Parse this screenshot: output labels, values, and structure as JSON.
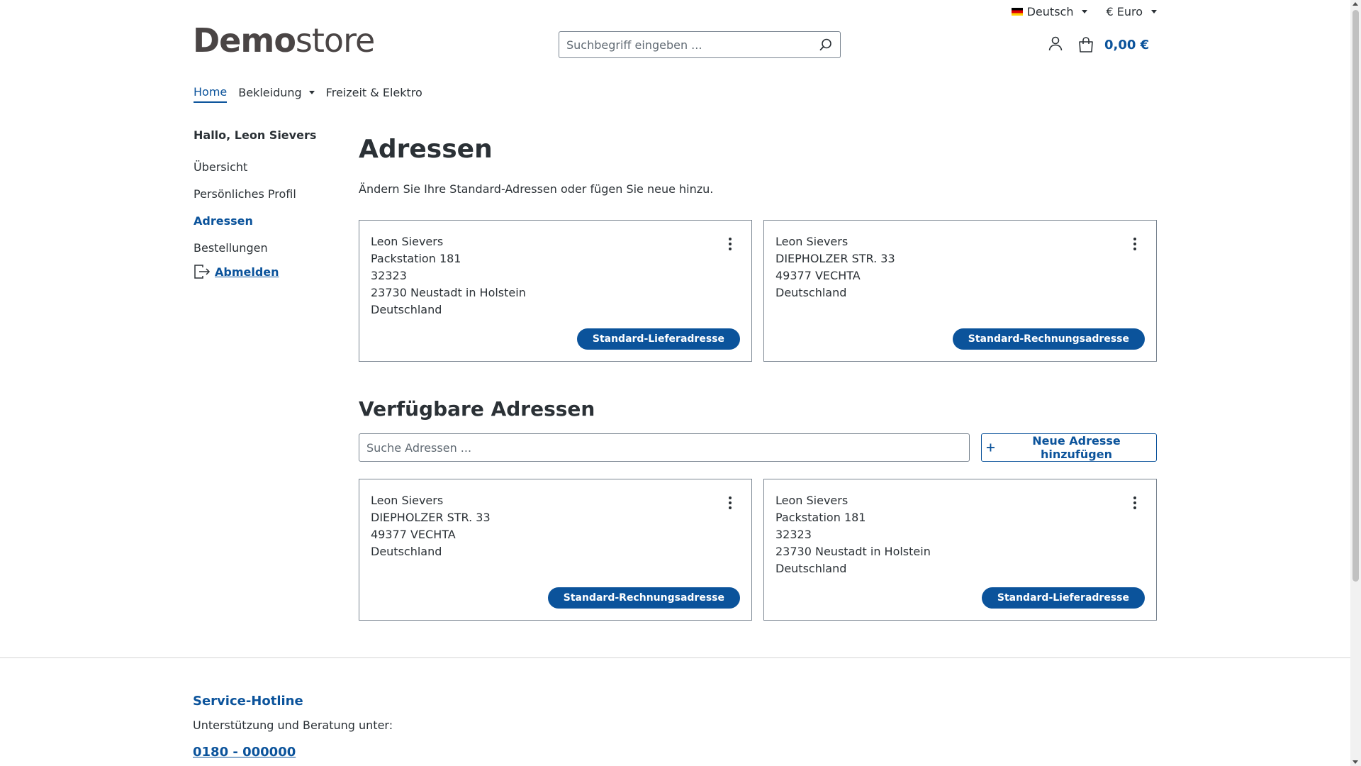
{
  "topbar": {
    "language": {
      "label": "Deutsch",
      "icon": "germany-flag-icon"
    },
    "currency": {
      "label": "€ Euro"
    }
  },
  "header": {
    "logo": {
      "bold": "Demo",
      "light": "store"
    },
    "search": {
      "placeholder": "Suchbegriff eingeben ...",
      "value": "",
      "icon": "search-icon"
    },
    "account_icon": "user-icon",
    "cart": {
      "icon": "shopping-bag-icon",
      "total": "0,00 €"
    }
  },
  "nav": {
    "items": [
      {
        "label": "Home",
        "active": true
      },
      {
        "label": "Bekleidung",
        "dropdown": true
      },
      {
        "label": "Freizeit & Elektro"
      }
    ]
  },
  "sidebar": {
    "greeting": "Hallo, Leon Sievers",
    "items": [
      {
        "label": "Übersicht"
      },
      {
        "label": "Persönliches Profil"
      },
      {
        "label": "Adressen",
        "active": true
      },
      {
        "label": "Bestellungen"
      }
    ],
    "logout": {
      "label": "Abmelden",
      "icon": "logout-icon"
    }
  },
  "main": {
    "title": "Adressen",
    "subtitle": "Ändern Sie Ihre Standard-Adressen oder fügen Sie neue hinzu.",
    "default_addresses": [
      {
        "lines": [
          "Leon Sievers",
          "Packstation 181",
          "32323",
          "23730 Neustadt in Holstein",
          "Deutschland"
        ],
        "badge": "Standard-Lieferadresse"
      },
      {
        "lines": [
          "Leon Sievers",
          "DIEPHOLZER STR. 33",
          "49377 VECHTA",
          "Deutschland"
        ],
        "badge": "Standard-Rechnungsadresse"
      }
    ],
    "available_title": "Verfügbare Adressen",
    "address_search": {
      "placeholder": "Suche Adressen ...",
      "value": ""
    },
    "add_button": {
      "label": "Neue Adresse hinzufügen",
      "icon": "plus-icon"
    },
    "available_addresses": [
      {
        "lines": [
          "Leon Sievers",
          "DIEPHOLZER STR. 33",
          "49377 VECHTA",
          "Deutschland"
        ],
        "badge": "Standard-Rechnungsadresse"
      },
      {
        "lines": [
          "Leon Sievers",
          "Packstation 181",
          "32323",
          "23730 Neustadt in Holstein",
          "Deutschland"
        ],
        "badge": "Standard-Lieferadresse"
      }
    ]
  },
  "footer": {
    "title": "Service-Hotline",
    "text": "Unterstützung und Beratung unter:",
    "phone": "0180 - 000000"
  },
  "colors": {
    "accent": "#0b539b",
    "text": "#2b3136",
    "border": "#798490"
  }
}
